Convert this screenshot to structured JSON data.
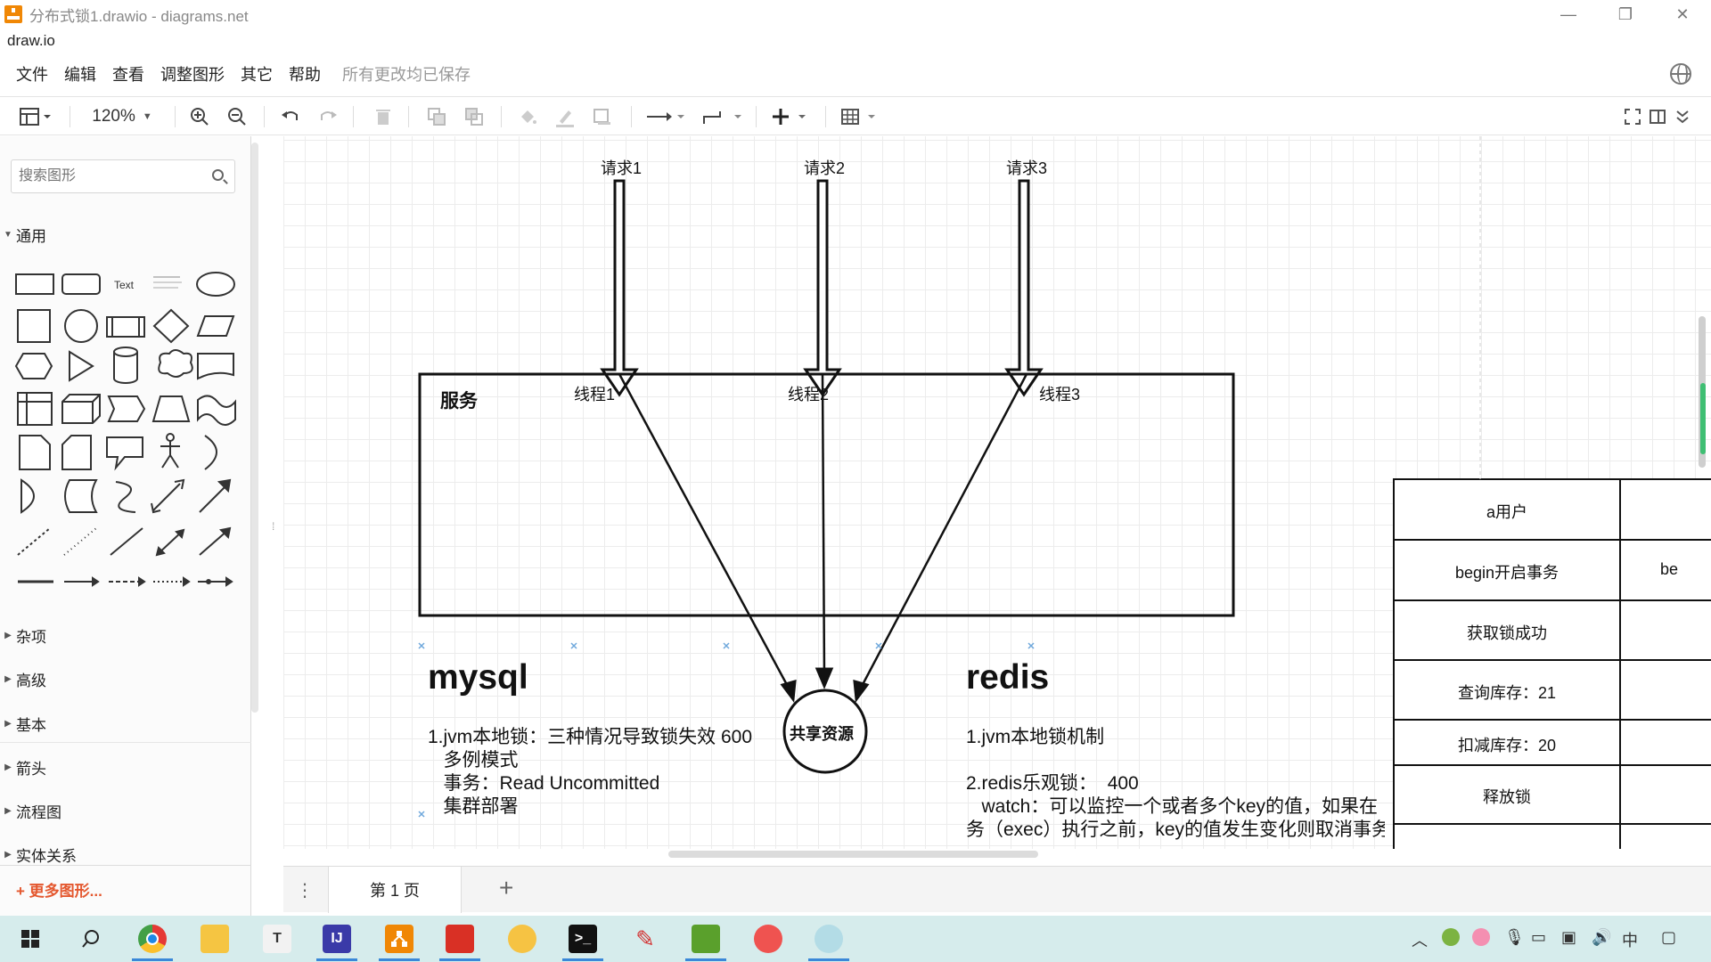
{
  "window": {
    "title": "分布式锁1.drawio - diagrams.net",
    "app_name": "draw.io",
    "controls": [
      "—",
      "❐",
      "✕"
    ]
  },
  "menu": {
    "items": [
      "文件",
      "编辑",
      "查看",
      "调整图形",
      "其它",
      "帮助"
    ],
    "status": "所有更改均已保存"
  },
  "toolbar": {
    "zoom": "120%"
  },
  "sidebar": {
    "search_placeholder": "搜索图形",
    "general": "通用",
    "text_shape": "Text",
    "sections": [
      "杂项",
      "高级",
      "基本",
      "箭头",
      "流程图",
      "实体关系"
    ],
    "more_shapes": "+ 更多图形..."
  },
  "diagram": {
    "requests": [
      "请求1",
      "请求2",
      "请求3"
    ],
    "service_title": "服务",
    "threads": [
      "线程1",
      "线程2",
      "线程3"
    ],
    "shared_resource": "共享资源",
    "mysql": {
      "title": "mysql",
      "lines": [
        "1.jvm本地锁：三种情况导致锁失效  600",
        "   多例模式",
        "   事务：Read Uncommitted",
        "   集群部署"
      ]
    },
    "redis": {
      "title": "redis",
      "lines": [
        "1.jvm本地锁机制",
        "",
        "2.redis乐观锁：  400",
        "   watch：可以监控一个或者多个key的值，如果在",
        "务（exec）执行之前，key的值发生变化则取消事务"
      ]
    },
    "table": {
      "rows": [
        "a用户",
        "begin开启事务",
        "获取锁成功",
        "查询库存：21",
        "扣减库存：20",
        "释放锁"
      ],
      "col2_partial": "be"
    }
  },
  "pages": {
    "current": "第 1 页"
  },
  "colors": {
    "brand": "#f08705",
    "taskbar": "#d6ecec",
    "more_shapes": "#e4572e"
  }
}
